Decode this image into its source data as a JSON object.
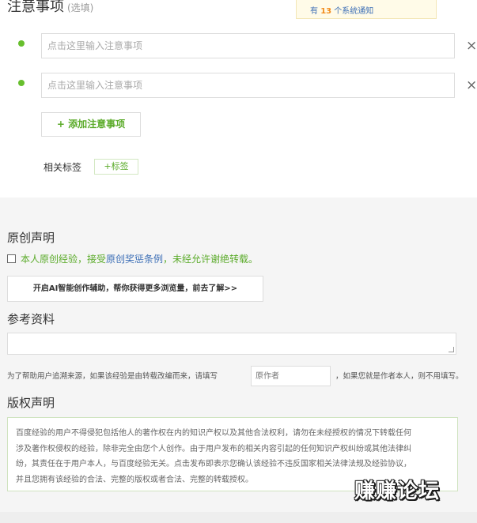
{
  "notes": {
    "title": "注意事项",
    "optional": "(选填)",
    "items": [
      {
        "placeholder": "点击这里输入注意事项"
      },
      {
        "placeholder": "点击这里输入注意事项"
      }
    ],
    "close_glyph": "×",
    "add_label": "+ 添加注意事项"
  },
  "notice": {
    "prefix": "有 ",
    "count": "13",
    "suffix": " 个系统通知"
  },
  "tags": {
    "label": "相关标签",
    "add_label": "+标签"
  },
  "original": {
    "title": "原创声明",
    "text_before": "本人原创经验，接受",
    "link_text": "原创奖惩条例",
    "text_after": "，未经允许谢绝转载。",
    "checked": false
  },
  "ai_button": {
    "label": "开启AI智能创作辅助，帮你获得更多浏览量，前去了解>>"
  },
  "reference": {
    "title": "参考资料",
    "hint_before": "为了帮助用户追溯来源，如果该经验是由转载改编而来，请填写",
    "author_placeholder": "原作者",
    "hint_after": "，如果您就是作者本人，则不用填写。"
  },
  "copyright": {
    "title": "版权声明",
    "lines": [
      "百度经验的用户不得侵犯包括他人的著作权在内的知识产权以及其他合法权利，请勿在未经授权的情况下转载任何",
      "涉及著作权侵权的经验，除非完全由您个人创作。由于用户发布的相关内容引起的任何知识产权纠纷或其他法律纠",
      "纷，其责任在于用户本人，与百度经验无关。点击发布即表示您确认该经验不违反国家相关法律法规及经验协议，",
      "并且您拥有该经验的合法、完整的版权或者合法、完整的转载授权。"
    ]
  },
  "watermark": {
    "text": "赚赚论坛"
  },
  "colors": {
    "accent_green": "#5bab2a",
    "link_blue": "#3d6fb6",
    "notice_orange": "#f28c1c"
  }
}
